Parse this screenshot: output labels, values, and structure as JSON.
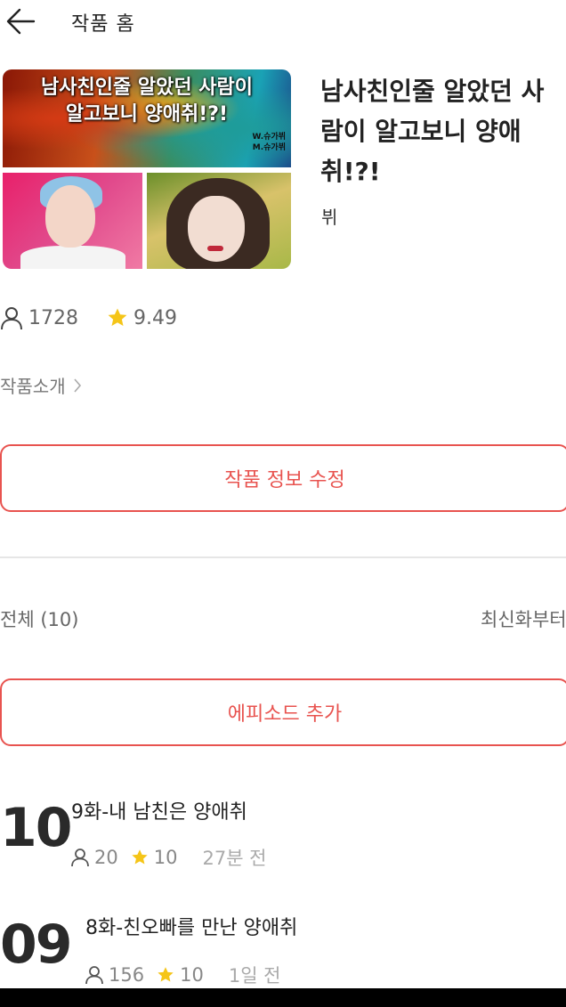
{
  "header": {
    "title": "작품 홈",
    "back_icon": "arrow-left-icon"
  },
  "cover": {
    "line1": "남사친인줄 알았던 사람이",
    "line2": "알고보니 양애취!?!",
    "credit_w": "W.슈가뷔",
    "credit_m": "M.슈가뷔"
  },
  "story": {
    "title": "남사친인줄 알았던 사람이 알고보니 양애취!?!",
    "author": "뷔",
    "views": "1728",
    "rating": "9.49",
    "intro_label": "작품소개"
  },
  "actions": {
    "edit_label": "작품 정보 수정",
    "add_episode_label": "에피소드 추가"
  },
  "list": {
    "count_label": "전체 (10)",
    "sort_label": "최신화부터"
  },
  "episodes": [
    {
      "number": "10",
      "title": "9화-내 남친은 양애취",
      "views": "20",
      "rating": "10",
      "time": "27분 전"
    },
    {
      "number": "09",
      "title": "8화-친오빠를 만난 양애취",
      "views": "156",
      "rating": "10",
      "time": "1일 전"
    }
  ],
  "colors": {
    "accent": "#e8534f",
    "star": "#f5c518"
  }
}
